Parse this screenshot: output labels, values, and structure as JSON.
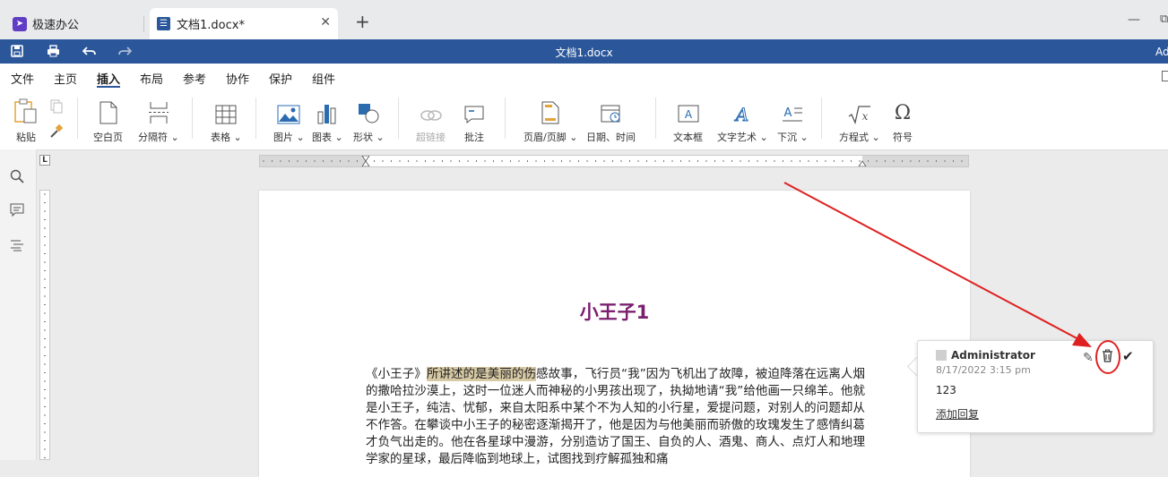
{
  "tabs": {
    "home_label": "极速办公",
    "doc_label": "文档1.docx*",
    "close_glyph": "✕",
    "add_glyph": "+"
  },
  "window": {
    "minimize_glyph": "—",
    "restore_glyph": "⧉"
  },
  "titlebar": {
    "title": "文档1.docx",
    "user_short": "Ad"
  },
  "menu": {
    "items": [
      "文件",
      "主页",
      "插入",
      "布局",
      "参考",
      "协作",
      "保护",
      "组件"
    ],
    "active": "插入"
  },
  "ribbon": {
    "paste": "粘贴",
    "blank_page": "空白页",
    "break": "分隔符",
    "table": "表格",
    "image": "图片",
    "chart": "图表",
    "shape": "形状",
    "hyperlink": "超链接",
    "comment": "批注",
    "header_footer": "页眉/页脚",
    "datetime": "日期、时间",
    "textbox": "文本框",
    "textart": "文字艺术",
    "dropcap": "下沉",
    "equation": "方程式",
    "symbol": "符号"
  },
  "ruler": {
    "corner": "L"
  },
  "document": {
    "heading": "小王子1",
    "body_before": "《小王子》",
    "body_highlight": "所讲述的是美丽的伤",
    "body_after": "感故事，飞行员“我”因为飞机出了故障，被迫降落在远离人烟的撒哈拉沙漠上，这时一位迷人而神秘的小男孩出现了，执拗地请“我”给他画一只绵羊。他就是小王子，纯洁、忧郁，来自太阳系中某个不为人知的小行星，爱提问题，对别人的问题却从不作答。在攀谈中小王子的秘密逐渐揭开了，他是因为与他美丽而骄傲的玫瑰发生了感情纠葛才负气出走的。他在各星球中漫游，分别造访了国王、自负的人、酒鬼、商人、点灯人和地理学家的星球，最后降临到地球上，试图找到疗解孤独和痛"
  },
  "comment": {
    "author": "Administrator",
    "date": "8/17/2022 3:15 pm",
    "text": "123",
    "reply_label": "添加回复",
    "edit_glyph": "✎",
    "delete_glyph": "🗑",
    "resolve_glyph": "✔"
  },
  "colors": {
    "accent": "#2b579a",
    "heading": "#7b1f6f",
    "highlight": "#d7c9a4",
    "annotation": "#e02020"
  }
}
